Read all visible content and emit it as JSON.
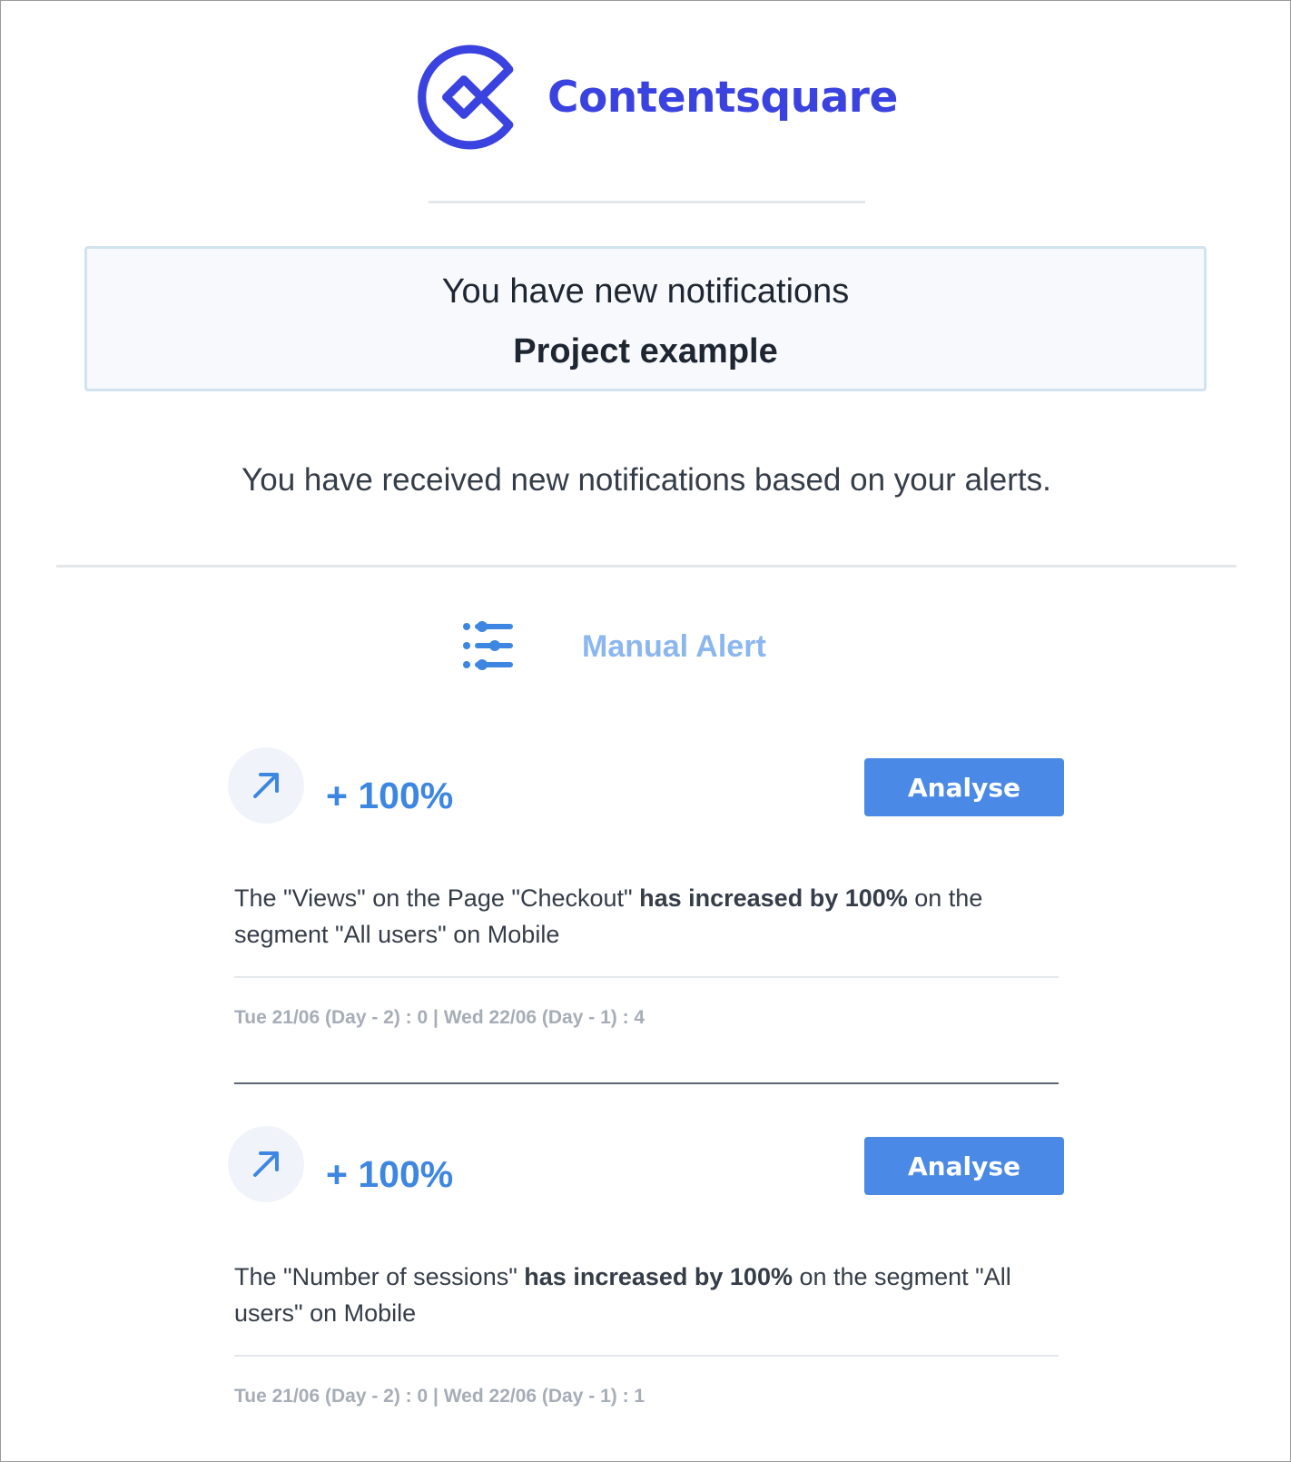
{
  "brand": {
    "name": "Contentsquare",
    "logo_icon": "contentsquare-logo-icon",
    "color": "#3a42e0"
  },
  "notification_box": {
    "title": "You have new notifications",
    "project": "Project example"
  },
  "intro_text": "You have received new notifications based on your alerts.",
  "alert_group": {
    "icon": "sliders-icon",
    "title": "Manual Alert",
    "title_color": "#8bb6f0"
  },
  "alerts": [
    {
      "trend_icon": "arrow-up-right-icon",
      "change": "+ 100%",
      "button_label": "Analyse",
      "description": {
        "prefix": "The \"Views\" on the Page \"Checkout\" ",
        "emphasis": "has increased by 100%",
        "suffix": " on the segment \"All users\" on Mobile"
      },
      "history": "Tue 21/06 (Day - 2) : 0 | Wed 22/06 (Day - 1) : 4"
    },
    {
      "trend_icon": "arrow-up-right-icon",
      "change": "+ 100%",
      "button_label": "Analyse",
      "description": {
        "prefix": "The \"Number of sessions\" ",
        "emphasis": "has increased by 100%",
        "suffix": " on the segment \"All users\" on Mobile"
      },
      "history": "Tue 21/06 (Day - 2) : 0 | Wed 22/06 (Day - 1) : 1"
    }
  ],
  "colors": {
    "accent": "#3d86e2",
    "button": "#4a8ae6",
    "muted": "#a6adb7"
  }
}
